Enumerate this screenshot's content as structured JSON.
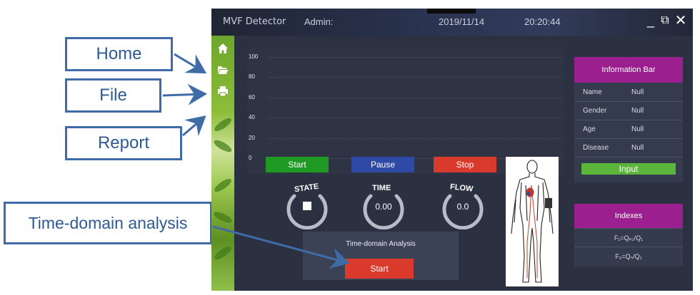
{
  "annotations": {
    "home": "Home",
    "file": "File",
    "report": "Report",
    "time_domain": "Time-domain analysis"
  },
  "titlebar": {
    "app_name": "MVF Detector",
    "admin": "Admin:",
    "date": "2019/11/14",
    "time": "20:20:44",
    "minimize": "_",
    "restore": "⧉",
    "close": "✕"
  },
  "chart_data": {
    "type": "line",
    "title": "",
    "xlabel": "",
    "ylabel": "",
    "ylim": [
      0,
      100
    ],
    "yticks": [
      "100",
      "80",
      "60",
      "40",
      "20",
      "0"
    ],
    "grid": true,
    "series": []
  },
  "controls": {
    "start": "Start",
    "pause": "Pause",
    "stop": "Stop"
  },
  "gauges": {
    "state_label": "STATE",
    "time_label": "TIME",
    "time_value": "0.00",
    "flow_label": "FLOW",
    "flow_value": "0.0"
  },
  "time_domain": {
    "title": "Time-domain Analysis",
    "start": "Start"
  },
  "info_bar": {
    "title": "Information Bar",
    "rows": [
      {
        "label": "Name",
        "value": "Null"
      },
      {
        "label": "Gender",
        "value": "Null"
      },
      {
        "label": "Age",
        "value": "Null"
      },
      {
        "label": "Disease",
        "value": "Null"
      }
    ],
    "input": "Input"
  },
  "indexes": {
    "title": "Indexes",
    "f1": "F₁=Qₚ₁/Q₁",
    "f2": "F₂=Qₙ/Q₁"
  },
  "colors": {
    "green_button": "#1f9a22",
    "blue_button": "#2e4aa6",
    "red_button": "#d93a2b",
    "header_purple": "#9b1f8f",
    "input_green": "#5cb53b",
    "callout_border": "#3f6ba6"
  },
  "icons": {
    "home": "home-icon",
    "file": "folder-open-icon",
    "report": "printer-icon"
  }
}
